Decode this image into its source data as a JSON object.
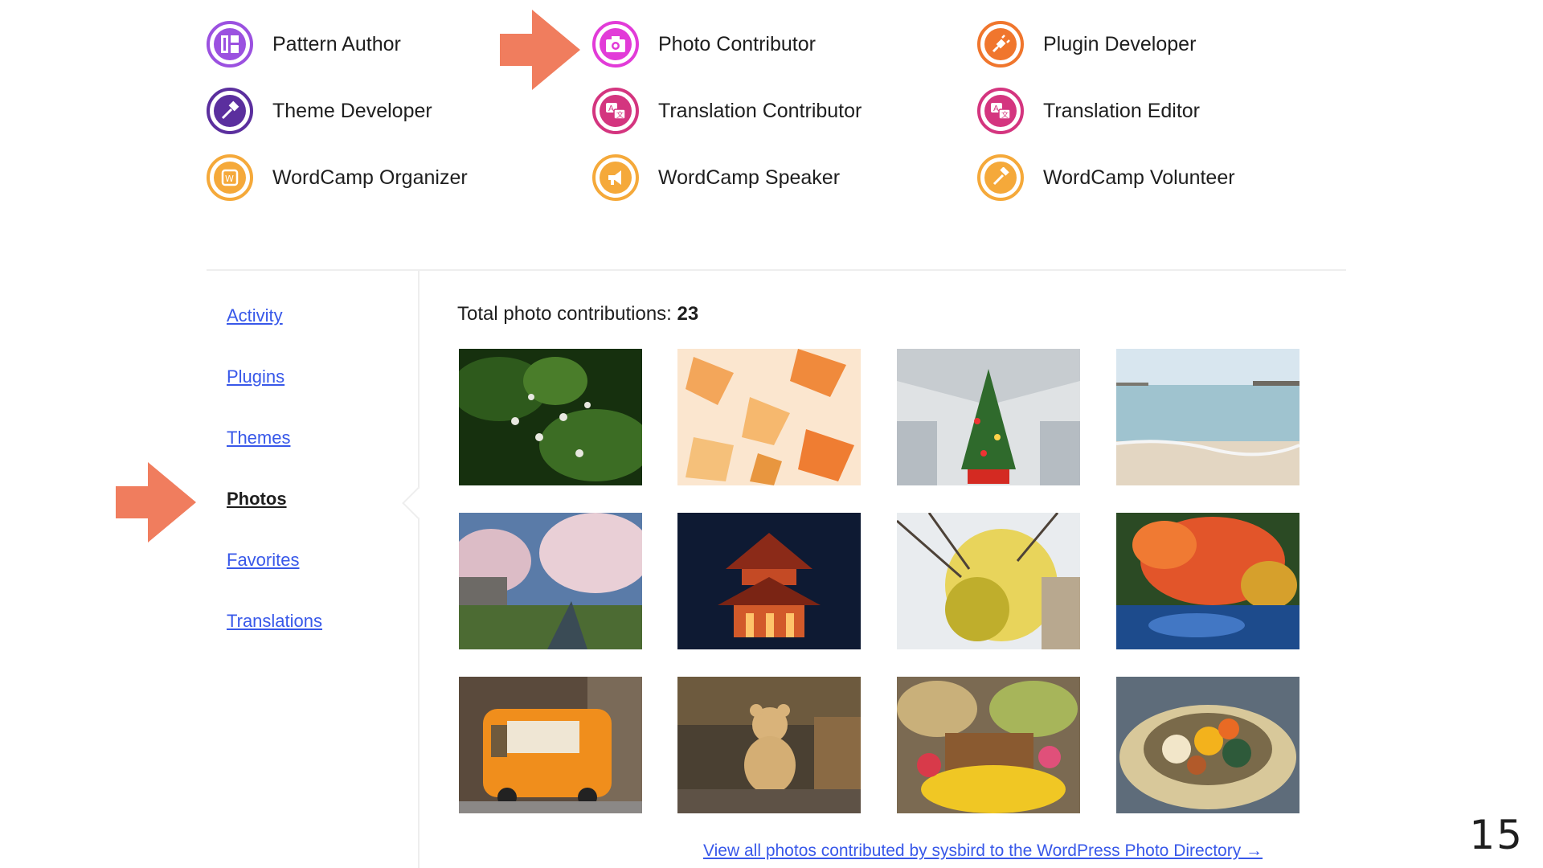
{
  "badges": [
    {
      "label": "Pattern Author",
      "color": "#9b51e0",
      "icon": "pattern-icon"
    },
    {
      "label": "Photo Contributor",
      "color": "#e23bd8",
      "icon": "camera-icon"
    },
    {
      "label": "Plugin Developer",
      "color": "#f0762d",
      "icon": "plug-icon"
    },
    {
      "label": "Theme Developer",
      "color": "#5b2f9e",
      "icon": "brush-icon"
    },
    {
      "label": "Translation Contributor",
      "color": "#d4357f",
      "icon": "translate-icon"
    },
    {
      "label": "Translation Editor",
      "color": "#d4357f",
      "icon": "translate-icon"
    },
    {
      "label": "WordCamp Organizer",
      "color": "#f5a93a",
      "icon": "wordcamp-icon"
    },
    {
      "label": "WordCamp Speaker",
      "color": "#f5a93a",
      "icon": "megaphone-icon"
    },
    {
      "label": "WordCamp Volunteer",
      "color": "#f5a93a",
      "icon": "hammer-icon"
    }
  ],
  "nav": {
    "items": [
      "Activity",
      "Plugins",
      "Themes",
      "Photos",
      "Favorites",
      "Translations"
    ],
    "active": "Photos"
  },
  "photos": {
    "total_label": "Total photo contributions:",
    "total_count": "23",
    "thumbnails": [
      "green-leaves-flowers",
      "orange-maple-leaves",
      "christmas-tree-station",
      "calm-sea",
      "cherry-blossoms-river",
      "red-pagoda-night",
      "yellow-mimosa",
      "autumn-leaves-pond",
      "orange-food-truck",
      "teddy-bear-cafe",
      "flower-market",
      "pumpkin-basket"
    ],
    "view_all": "View all photos contributed by sysbird to the WordPress Photo Directory →"
  },
  "slide": {
    "page_number": "15"
  },
  "colors": {
    "link": "#3858e9",
    "arrow": "#f07d5e",
    "text": "#1e1e1e"
  }
}
